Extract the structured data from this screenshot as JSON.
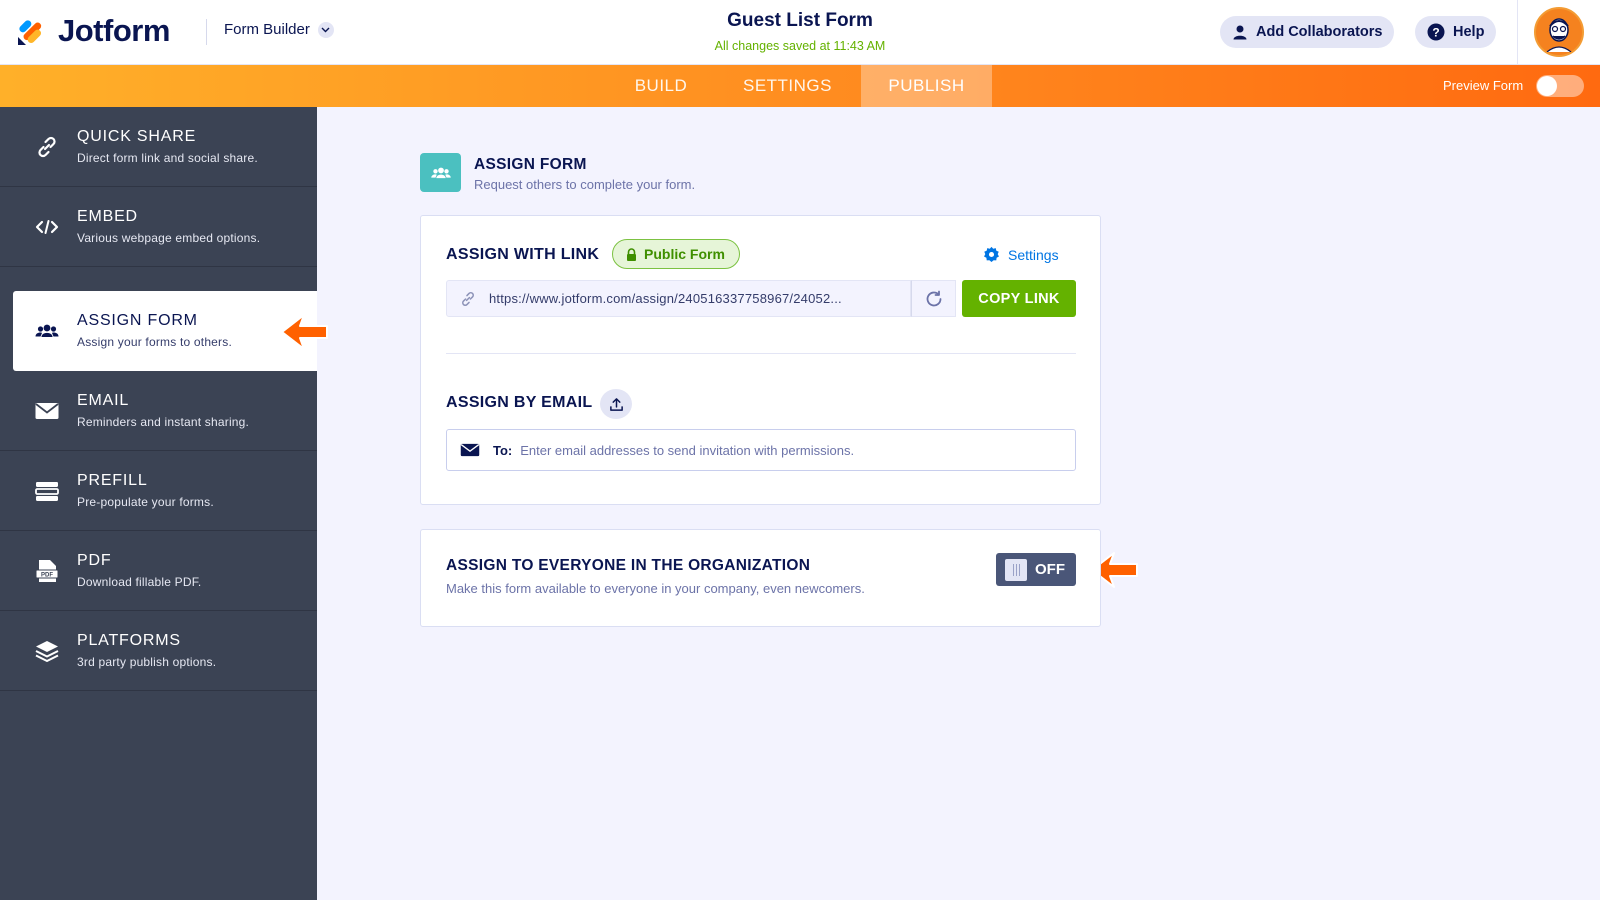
{
  "header": {
    "brand": "Jotform",
    "builder_label": "Form Builder",
    "form_title": "Guest List Form",
    "saved_status": "All changes saved at 11:43 AM",
    "collab_label": "Add Collaborators",
    "help_label": "Help"
  },
  "nav": {
    "tabs": [
      {
        "label": "BUILD"
      },
      {
        "label": "SETTINGS"
      },
      {
        "label": "PUBLISH"
      }
    ],
    "active_tab": "PUBLISH",
    "preview_label": "Preview Form"
  },
  "sidebar": {
    "items": [
      {
        "title": "QUICK SHARE",
        "subtitle": "Direct form link and social share.",
        "icon": "link-icon"
      },
      {
        "title": "EMBED",
        "subtitle": "Various webpage embed options.",
        "icon": "code-icon"
      },
      {
        "title": "ASSIGN FORM",
        "subtitle": "Assign your forms to others.",
        "icon": "users-icon"
      },
      {
        "title": "EMAIL",
        "subtitle": "Reminders and instant sharing.",
        "icon": "envelope-icon"
      },
      {
        "title": "PREFILL",
        "subtitle": "Pre-populate your forms.",
        "icon": "prefill-icon"
      },
      {
        "title": "PDF",
        "subtitle": "Download fillable PDF.",
        "icon": "pdf-icon"
      },
      {
        "title": "PLATFORMS",
        "subtitle": "3rd party publish options.",
        "icon": "layers-icon"
      }
    ],
    "active": "ASSIGN FORM"
  },
  "main": {
    "section_title": "ASSIGN FORM",
    "section_subtitle": "Request others to complete your form.",
    "assign_link": {
      "label": "ASSIGN WITH LINK",
      "badge": "Public Form",
      "settings_label": "Settings",
      "url": "https://www.jotform.com/assign/240516337758967/24052...",
      "copy_label": "COPY LINK"
    },
    "assign_email": {
      "label": "ASSIGN BY EMAIL",
      "to_label": "To:",
      "placeholder": "Enter email addresses to send invitation with permissions."
    },
    "organization": {
      "title": "ASSIGN TO EVERYONE IN THE ORGANIZATION",
      "subtitle": "Make this form available to everyone in your company, even newcomers.",
      "toggle_label": "OFF",
      "enabled": false
    }
  },
  "colors": {
    "accent_orange": "#ff6100",
    "sidebar_bg": "#3b4354",
    "copy_green": "#64b200",
    "assign_teal": "#4bc0c0"
  }
}
